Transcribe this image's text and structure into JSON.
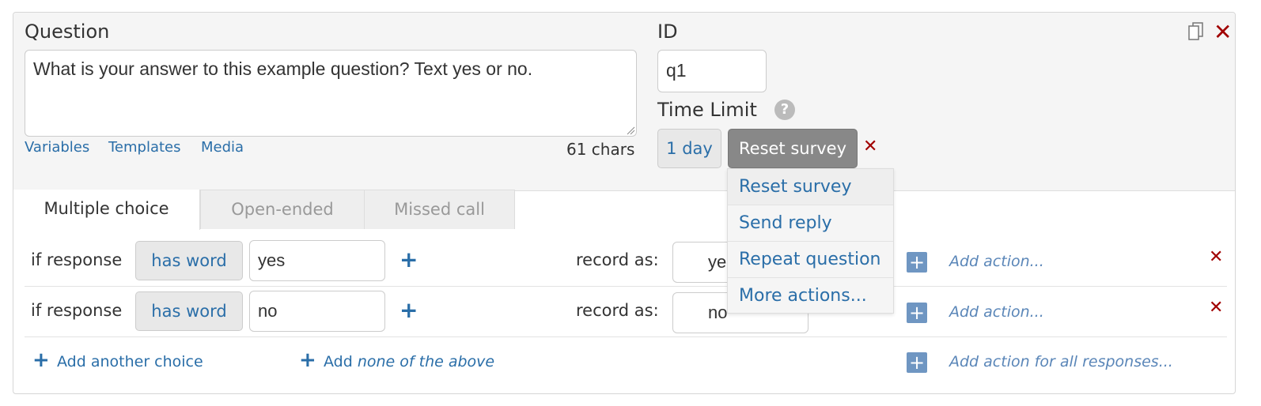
{
  "question": {
    "label": "Question",
    "text": "What is your answer to this example question? Text yes or no.",
    "links": [
      "Variables",
      "Templates",
      "Media"
    ],
    "char_count": "61 chars"
  },
  "id_field": {
    "label": "ID",
    "value": "q1"
  },
  "time_limit": {
    "label": "Time Limit",
    "help_glyph": "?",
    "duration": "1 day",
    "action": "Reset survey"
  },
  "dropdown": {
    "items": [
      "Reset survey",
      "Send reply",
      "Repeat question",
      "More actions..."
    ]
  },
  "tabs": [
    "Multiple choice",
    "Open-ended",
    "Missed call"
  ],
  "choices": [
    {
      "prefix": "if response",
      "matcher": "has word",
      "word": "yes",
      "record_label": "record as:",
      "record_value": "yes",
      "add_action": "Add action..."
    },
    {
      "prefix": "if response",
      "matcher": "has word",
      "word": "no",
      "record_label": "record as:",
      "record_value": "no",
      "add_action": "Add action..."
    }
  ],
  "footer": {
    "add_choice": "Add another choice",
    "add_none_prefix": "Add",
    "add_none_italic": "none of the above",
    "add_all": "Add action for all responses..."
  },
  "colors": {
    "accent": "#2a6ea8",
    "danger": "#a10000",
    "add_box": "#6f96c2"
  }
}
